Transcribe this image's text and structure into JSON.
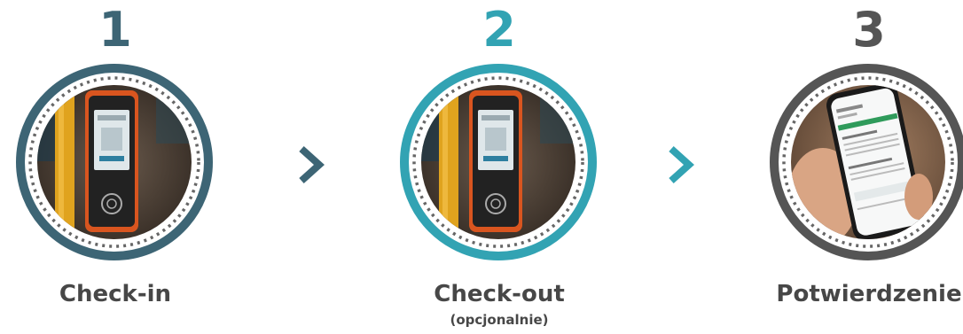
{
  "steps": [
    {
      "number": "1",
      "label": "Check-in",
      "sublabel": "",
      "ring_color": "#3d6575",
      "image": "validator-terminal-on-vehicle"
    },
    {
      "number": "2",
      "label": "Check-out",
      "sublabel": "(opcjonalnie)",
      "ring_color": "#32a3b3",
      "image": "validator-terminal-on-vehicle"
    },
    {
      "number": "3",
      "label": "Potwierdzenie",
      "sublabel": "",
      "ring_color": "#555555",
      "image": "hand-holding-smartphone-with-receipt"
    }
  ],
  "arrows": [
    {
      "icon": "chevron-right-icon",
      "color": "#3d6575"
    },
    {
      "icon": "chevron-right-icon",
      "color": "#32a3b3"
    }
  ]
}
